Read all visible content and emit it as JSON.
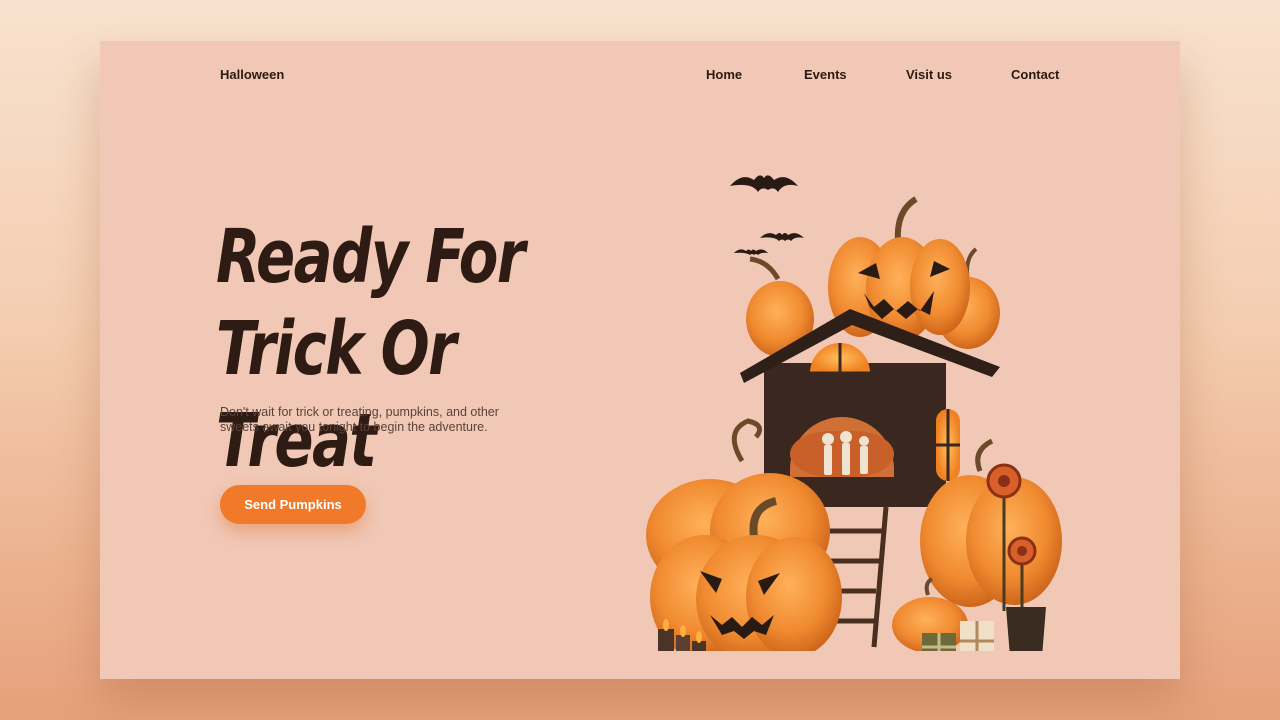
{
  "brand": "Halloween",
  "nav": [
    {
      "label": "Home"
    },
    {
      "label": "Events"
    },
    {
      "label": "Visit us"
    },
    {
      "label": "Contact"
    }
  ],
  "hero": {
    "headline_line1": "Ready For",
    "headline_line2": "Trick Or Treat",
    "subtext": "Don't wait for trick or treating, pumpkins, and other sweets await you tonight to begin the adventure.",
    "cta_label": "Send Pumpkins"
  },
  "colors": {
    "background": "#f0c8b5",
    "accent": "#f07a2a",
    "text": "#2c1a12",
    "pumpkin": "#f08a30"
  },
  "illustration": {
    "icons": [
      "bat-icon",
      "jack-o-lantern-icon",
      "haunted-house-icon",
      "pumpkin-icon",
      "skeleton-icon",
      "candle-icon",
      "gift-box-icon",
      "lollipop-icon"
    ]
  }
}
